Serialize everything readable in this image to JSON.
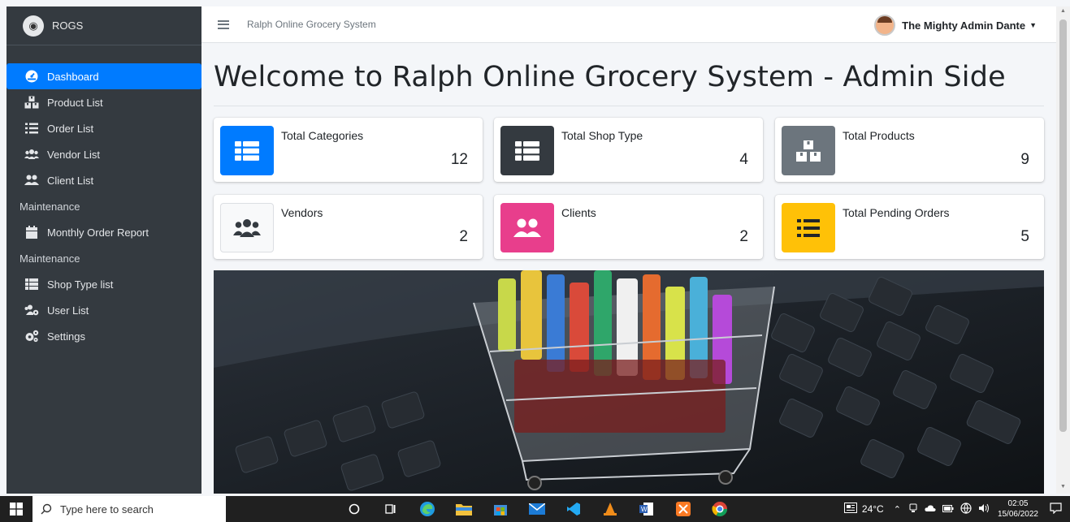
{
  "app": {
    "brand": "ROGS",
    "title": "Ralph Online Grocery System"
  },
  "user": {
    "name": "The Mighty Admin Dante"
  },
  "sidebar": {
    "items": [
      {
        "label": "Dashboard",
        "icon": "dashboard-icon",
        "active": true
      },
      {
        "label": "Product List",
        "icon": "boxes-icon"
      },
      {
        "label": "Order List",
        "icon": "list-icon"
      },
      {
        "label": "Vendor List",
        "icon": "users-icon"
      },
      {
        "label": "Client List",
        "icon": "user-friends-icon"
      }
    ],
    "sections": [
      {
        "header": "Maintenance",
        "items": [
          {
            "label": "Monthly Order Report",
            "icon": "calendar-icon"
          }
        ]
      },
      {
        "header": "Maintenance",
        "items": [
          {
            "label": "Shop Type list",
            "icon": "th-list-icon"
          },
          {
            "label": "User List",
            "icon": "users-cog-icon"
          },
          {
            "label": "Settings",
            "icon": "cogs-icon"
          }
        ]
      }
    ]
  },
  "main": {
    "page_title": "Welcome to Ralph Online Grocery System - Admin Side",
    "stats": [
      {
        "label": "Total Categories",
        "value": "12",
        "color": "#007bff",
        "icon": "th-list-icon"
      },
      {
        "label": "Total Shop Type",
        "value": "4",
        "color": "#343a40",
        "icon": "th-list-icon"
      },
      {
        "label": "Total Products",
        "value": "9",
        "color": "#6c757d",
        "icon": "boxes-icon"
      },
      {
        "label": "Vendors",
        "value": "2",
        "color": "#f8f9fa",
        "icon": "users-icon"
      },
      {
        "label": "Clients",
        "value": "2",
        "color": "#e83e8c",
        "icon": "user-friends-icon"
      },
      {
        "label": "Total Pending Orders",
        "value": "5",
        "color": "#ffc107",
        "icon": "list-icon"
      }
    ]
  },
  "taskbar": {
    "search_placeholder": "Type here to search",
    "weather": "24°C",
    "time": "02:05",
    "date": "15/06/2022"
  }
}
